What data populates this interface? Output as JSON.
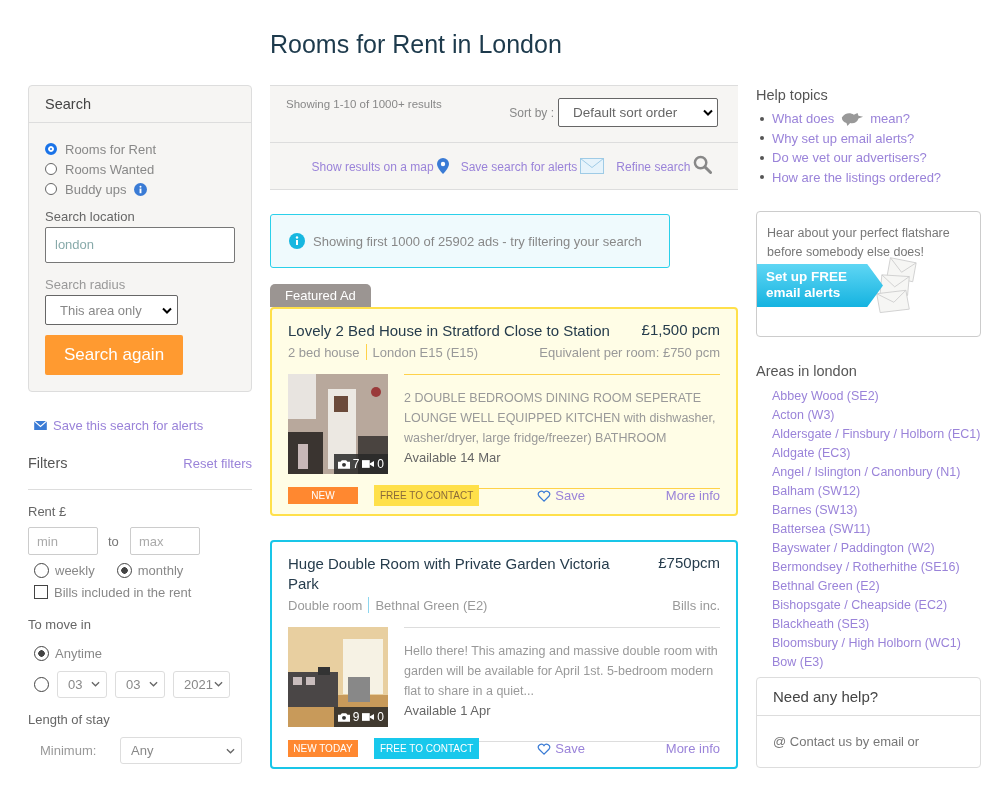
{
  "page_title": "Rooms for Rent in London",
  "search_panel": {
    "title": "Search",
    "types": [
      {
        "label": "Rooms for Rent",
        "selected": true,
        "info": false
      },
      {
        "label": "Rooms Wanted",
        "selected": false,
        "info": false
      },
      {
        "label": "Buddy ups",
        "selected": false,
        "info": true
      }
    ],
    "location_label": "Search location",
    "location_value": "london",
    "radius_label": "Search radius",
    "radius_value": "This area only",
    "button": "Search again"
  },
  "save_alert_link": "Save this search for alerts",
  "filters": {
    "title": "Filters",
    "reset": "Reset filters",
    "rent_label": "Rent £",
    "min_placeholder": "min",
    "to": "to",
    "max_placeholder": "max",
    "periods": [
      {
        "label": "weekly",
        "selected": false
      },
      {
        "label": "monthly",
        "selected": true
      }
    ],
    "bills": {
      "label": "Bills included in the rent",
      "checked": false
    },
    "move_in_label": "To move in",
    "anytime": {
      "label": "Anytime",
      "selected": true
    },
    "date": {
      "selected": false,
      "day": "03",
      "month": "03",
      "year": "2021"
    },
    "stay_label": "Length of stay",
    "minimum_label": "Minimum:",
    "minimum_value": "Any"
  },
  "results_bar": {
    "count": "Showing 1-10 of 1000+ results",
    "sort_label": "Sort by :",
    "sort_value": "Default sort order",
    "links": [
      {
        "label": "Show results on a map",
        "kind": "map"
      },
      {
        "label": "Save search for alerts",
        "kind": "mail"
      },
      {
        "label": "Refine search",
        "kind": "search"
      }
    ]
  },
  "notice": "Showing first 1000 of 25902 ads - try filtering your search",
  "listings": [
    {
      "featured": true,
      "featured_label": "Featured Ad",
      "title": "Lovely 2 Bed House in Stratford Close to Station",
      "price": "£1,500 pcm",
      "type": "2 bed house",
      "area": "London E15 (E15)",
      "extra": "Equivalent per room: £750 pcm",
      "description": "2 DOUBLE BEDROOMS DINING ROOM SEPERATE LOUNGE WELL EQUIPPED KITCHEN with dishwasher, washer/dryer, large fridge/freezer) BATHROOM",
      "available": "Available 14 Mar",
      "photos": "7",
      "videos": "0",
      "badge": "NEW",
      "contact": "FREE TO CONTACT",
      "save": "Save",
      "more": "More info"
    },
    {
      "featured": false,
      "title": "Huge Double Room with Private Garden Victoria Park",
      "price": "£750pcm",
      "type": "Double room",
      "area": "Bethnal Green (E2)",
      "extra": "Bills inc.",
      "description": "Hello there! This amazing and massive double room with garden will be available for April 1st. 5-bedroom modern flat to share in a quiet...",
      "available": "Available 1 Apr",
      "photos": "9",
      "videos": "0",
      "badge": "NEW TODAY",
      "contact": "FREE TO CONTACT",
      "save": "Save",
      "more": "More info"
    }
  ],
  "help": {
    "title": "Help topics",
    "items": [
      {
        "before": "What does",
        "after": "mean?",
        "icon": true
      },
      {
        "before": "Why set up email alerts?",
        "icon": false
      },
      {
        "before": "Do we vet our advertisers?",
        "icon": false
      },
      {
        "before": "How are the listings ordered?",
        "icon": false
      }
    ]
  },
  "alert_promo": {
    "text": "Hear about your perfect flatshare before somebody else does!",
    "banner": "Set up FREE email alerts"
  },
  "areas": {
    "title": "Areas in london",
    "items": [
      "Abbey Wood (SE2)",
      "Acton (W3)",
      "Aldersgate / Finsbury / Holborn (EC1)",
      "Aldgate (EC3)",
      "Angel / Islington / Canonbury (N1)",
      "Balham (SW12)",
      "Barnes (SW13)",
      "Battersea (SW11)",
      "Bayswater / Paddington (W2)",
      "Bermondsey / Rotherhithe (SE16)",
      "Bethnal Green (E2)",
      "Bishopsgate / Cheapside (EC2)",
      "Blackheath (SE3)",
      "Bloomsbury / High Holborn (WC1)",
      "Bow (E3)"
    ]
  },
  "help_box": {
    "title": "Need any help?",
    "text": "@ Contact us by email or"
  }
}
